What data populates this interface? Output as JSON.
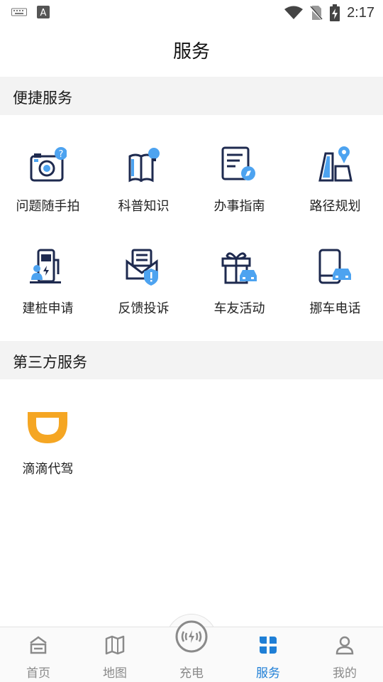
{
  "status_bar": {
    "time": "2:17"
  },
  "page": {
    "title": "服务"
  },
  "sections": {
    "convenience": {
      "title": "便捷服务",
      "items": [
        {
          "label": "问题随手拍",
          "icon": "camera-question-icon"
        },
        {
          "label": "科普知识",
          "icon": "book-lightbulb-icon"
        },
        {
          "label": "办事指南",
          "icon": "document-compass-icon"
        },
        {
          "label": "路径规划",
          "icon": "map-pin-icon"
        },
        {
          "label": "建桩申请",
          "icon": "charging-pile-icon"
        },
        {
          "label": "反馈投诉",
          "icon": "envelope-shield-icon"
        },
        {
          "label": "车友活动",
          "icon": "gift-car-icon"
        },
        {
          "label": "挪车电话",
          "icon": "phone-car-icon"
        }
      ]
    },
    "third_party": {
      "title": "第三方服务",
      "items": [
        {
          "label": "滴滴代驾",
          "icon": "didi-logo-icon"
        }
      ]
    }
  },
  "tabbar": {
    "tabs": [
      {
        "label": "首页",
        "icon": "home-icon",
        "active": false
      },
      {
        "label": "地图",
        "icon": "map-icon",
        "active": false
      },
      {
        "label": "充电",
        "icon": "charging-icon",
        "active": false
      },
      {
        "label": "服务",
        "icon": "services-icon",
        "active": true
      },
      {
        "label": "我的",
        "icon": "profile-icon",
        "active": false
      }
    ]
  },
  "colors": {
    "accent": "#1f7fd6",
    "icon_dark": "#1e2a4f",
    "icon_light": "#4da3f0",
    "didi_orange": "#f5a623"
  }
}
